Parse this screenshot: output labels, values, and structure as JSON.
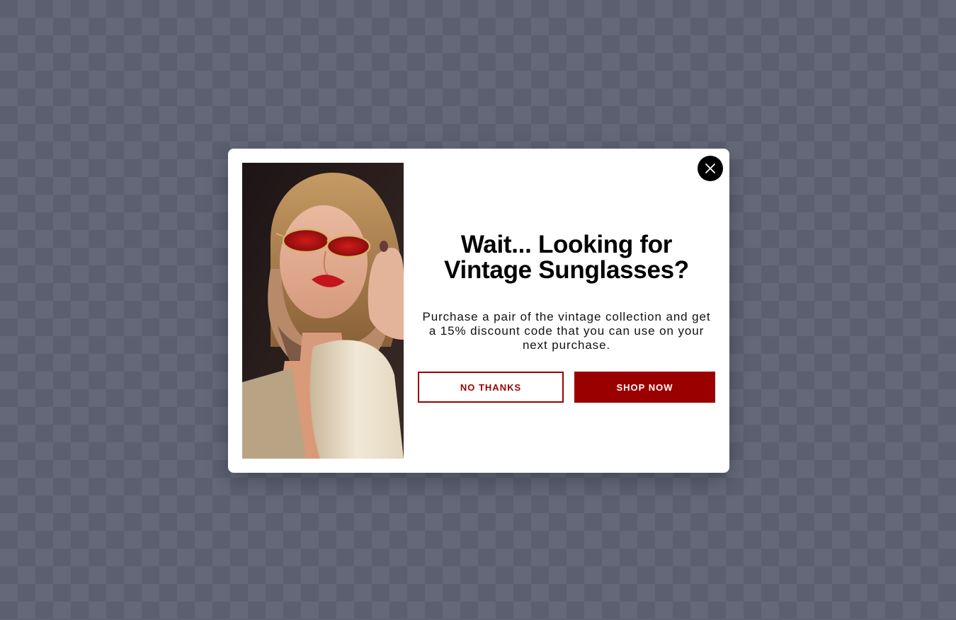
{
  "popup": {
    "headline_line1": "Wait... Looking for",
    "headline_line2": "Vintage Sunglasses?",
    "body": "Purchase a pair of the vintage collection and get a 15% discount code that you can use on your next purchase.",
    "no_thanks_label": "NO THANKS",
    "shop_now_label": "SHOP NOW",
    "close_icon": "close-icon",
    "image_subject": "woman-with-red-sunglasses"
  },
  "colors": {
    "accent": "#9b0000",
    "backdrop": "#5b5f70",
    "modal_bg": "#ffffff",
    "close_bg": "#000000"
  }
}
